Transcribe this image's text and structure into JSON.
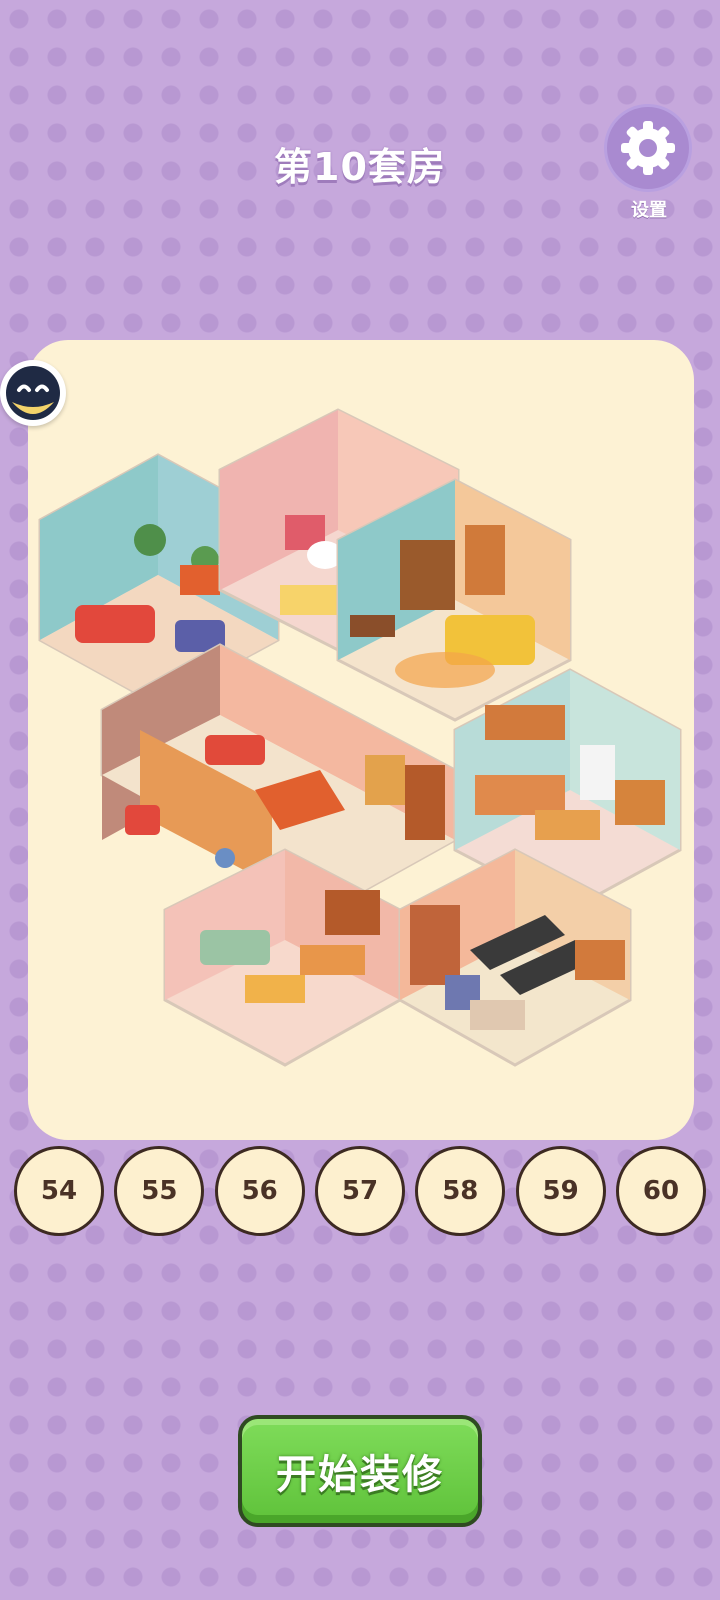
{
  "header": {
    "title": "第10套房"
  },
  "settings": {
    "label": "设置",
    "icon": "gear-icon"
  },
  "avatar": {
    "icon": "character-avatar-icon"
  },
  "levels": [
    "54",
    "55",
    "56",
    "57",
    "58",
    "59",
    "60"
  ],
  "start_button": {
    "label": "开始装修"
  },
  "colors": {
    "background": "#c6a8dc",
    "panel": "#fdf2d4",
    "button_green": "#6ccf48",
    "level_button": "#fdf0cf"
  }
}
